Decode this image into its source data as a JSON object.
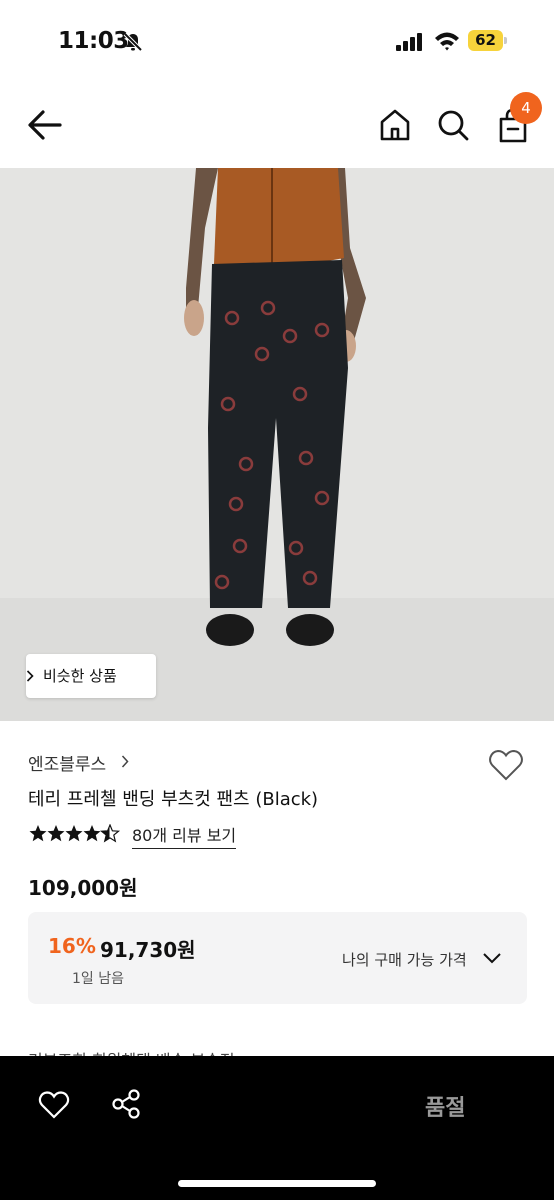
{
  "status_bar": {
    "time": "11:03",
    "battery_level": "62",
    "icons": [
      "bell-slash-icon",
      "signal-icon",
      "wifi-icon",
      "battery-icon"
    ]
  },
  "header": {
    "icons": [
      "back-arrow-icon",
      "home-icon",
      "search-icon",
      "shopping-bag-icon"
    ],
    "cart_count": "4"
  },
  "hero": {
    "similar_button_label": "비슷한 상품"
  },
  "product": {
    "brand": "엔조블루스",
    "title": "테리 프레첼 밴딩 부츠컷 팬츠 (Black)",
    "rating_stars": 4.5,
    "review_link": "80개 리뷰 보기",
    "original_price": "109,000원",
    "discount_rate": "16%",
    "sale_price": "91,730원",
    "days_left": "1일 남음",
    "my_price_label": "나의 구매 가능 가격"
  },
  "tabs_partial": "리뷰조회      회원혜택      배송      부속정",
  "bottom_bar": {
    "icons": [
      "heart-icon",
      "share-icon"
    ],
    "action_label": "품절"
  },
  "colors": {
    "accent": "#f0641e",
    "battery": "#f7d33b",
    "bottom_bar": "#000000",
    "disabled_text": "#9a9a9a"
  }
}
